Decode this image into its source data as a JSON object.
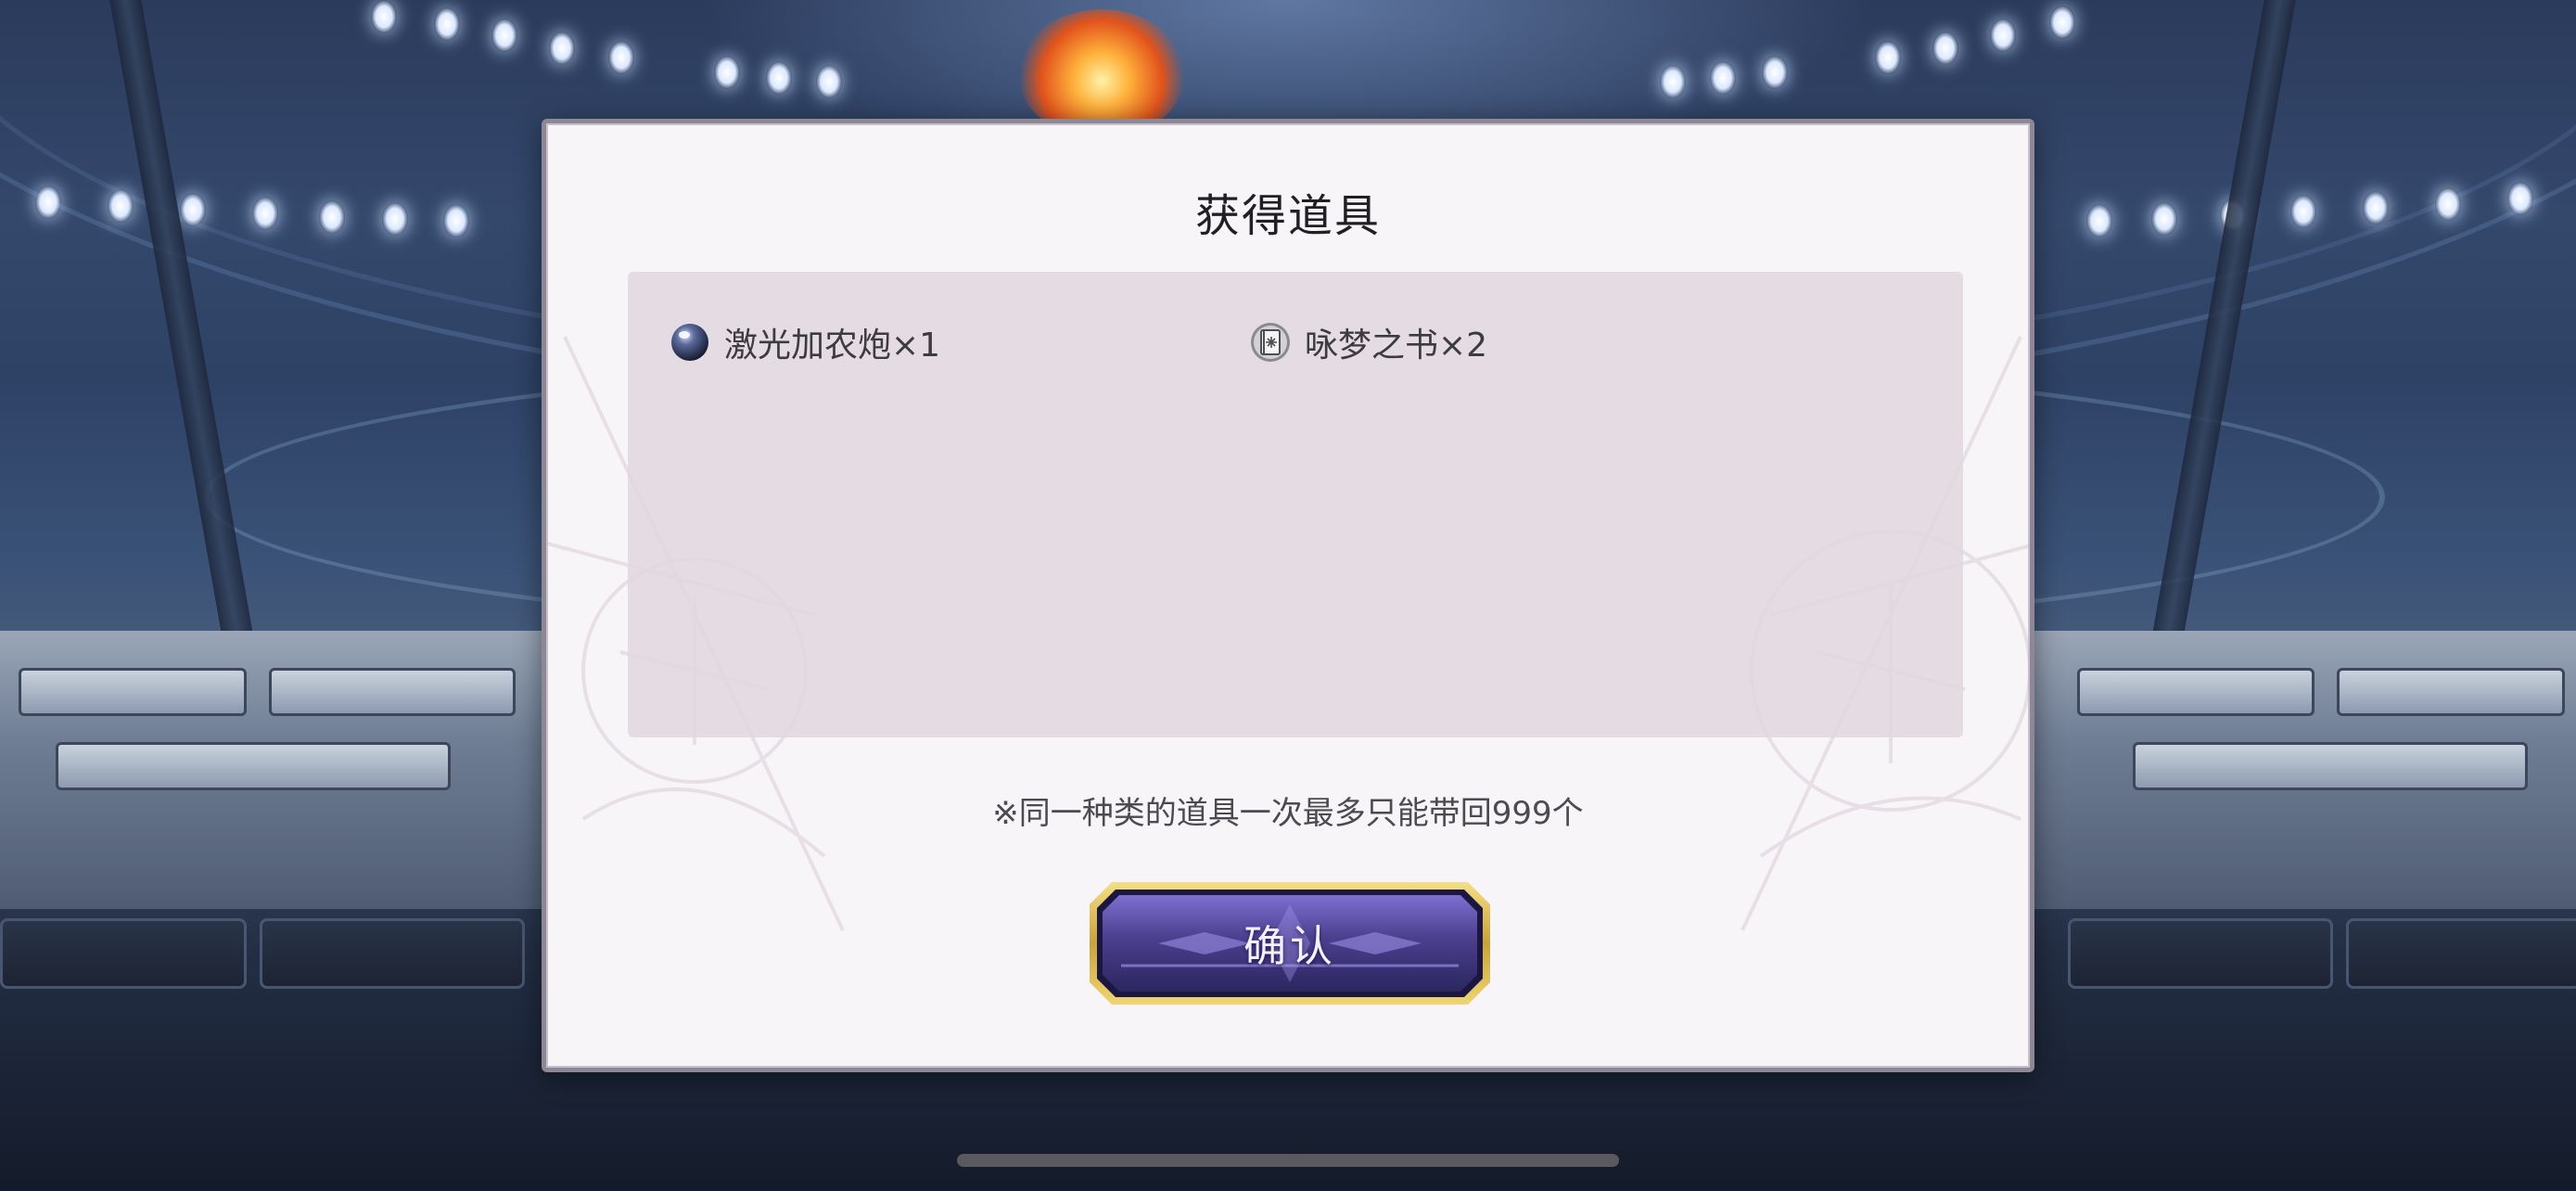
{
  "dialog": {
    "title": "获得道具",
    "items": [
      {
        "name": "激光加农炮×1",
        "icon": "orb-icon"
      },
      {
        "name": "咏梦之书×2",
        "icon": "book-icon"
      }
    ],
    "note": "※同一种类的道具一次最多只能带回999个",
    "confirm_label": "确认"
  },
  "colors": {
    "dialog_bg": "#f8f5f8",
    "panel_bg": "#e4dce2",
    "button_purple": "#5b4fa6",
    "button_gold": "#d8b84a"
  }
}
